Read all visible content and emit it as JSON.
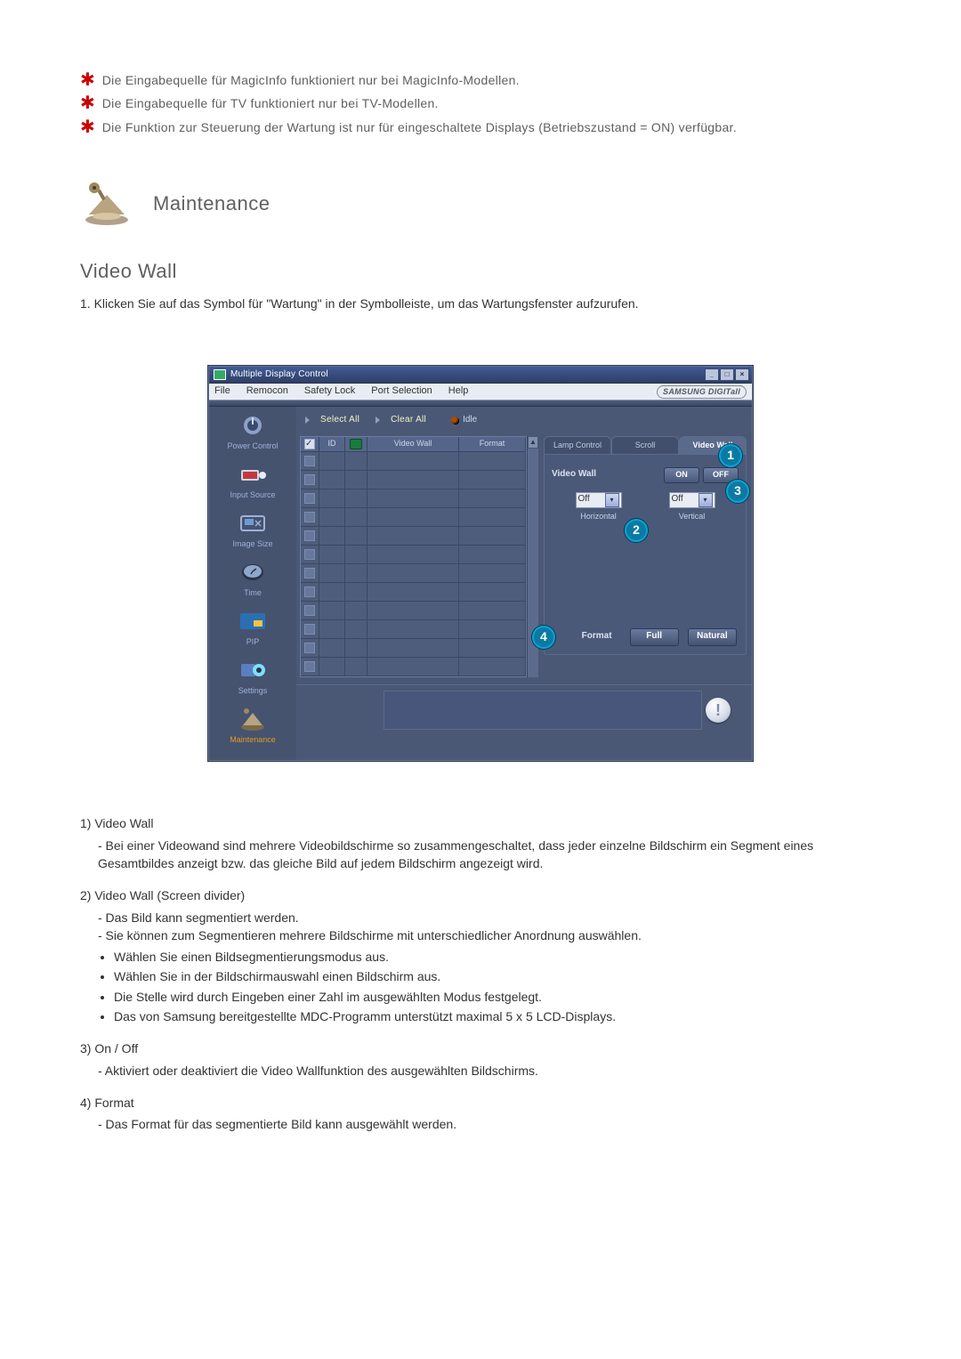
{
  "notes": [
    "Die Eingabequelle für MagicInfo funktioniert nur bei MagicInfo-Modellen.",
    "Die Eingabequelle für TV funktioniert nur bei TV-Modellen.",
    "Die Funktion zur Steuerung der Wartung ist nur für eingeschaltete Displays (Betriebszustand = ON) verfügbar."
  ],
  "section_title": "Maintenance",
  "subheading": "Video Wall",
  "step_text": "1. Klicken Sie auf das Symbol für \"Wartung\" in der Symbolleiste, um das Wartungsfenster aufzurufen.",
  "app": {
    "title": "Multiple Display Control",
    "menus": [
      "File",
      "Remocon",
      "Safety Lock",
      "Port Selection",
      "Help"
    ],
    "logo": "SAMSUNG DIGITall",
    "sidebar": [
      {
        "label": "Power Control"
      },
      {
        "label": "Input Source"
      },
      {
        "label": "Image Size"
      },
      {
        "label": "Time"
      },
      {
        "label": "PIP"
      },
      {
        "label": "Settings"
      },
      {
        "label": "Maintenance"
      }
    ],
    "toolbar": {
      "select_all": "Select All",
      "clear_all": "Clear All",
      "idle": "Idle"
    },
    "table": {
      "headers": {
        "id": "ID",
        "video_wall": "Video Wall",
        "format": "Format"
      },
      "row_count": 12
    },
    "panel": {
      "tabs": [
        "Lamp Control",
        "Scroll",
        "Video Wall"
      ],
      "active_tab_label": "Video Wall",
      "video_wall_label": "Video Wall",
      "on": "ON",
      "off": "OFF",
      "horizontal_label": "Horizontal",
      "vertical_label": "Vertical",
      "dd_value": "Off",
      "format_label": "Format",
      "full": "Full",
      "natural": "Natural"
    },
    "callouts": {
      "c1": "1",
      "c2": "2",
      "c3": "3",
      "c4": "4"
    },
    "status_icon": "!"
  },
  "definitions": [
    {
      "num": "1)",
      "title": "Video Wall",
      "lines": [
        "Bei einer Videowand sind mehrere Videobildschirme so zusammengeschaltet, dass jeder einzelne Bildschirm ein Segment eines Gesamtbildes anzeigt bzw. das gleiche Bild auf jedem Bildschirm angezeigt wird."
      ],
      "bullets": []
    },
    {
      "num": "2)",
      "title": "Video Wall (Screen divider)",
      "lines": [
        "Das Bild kann segmentiert werden.",
        "Sie können zum Segmentieren mehrere Bildschirme mit unterschiedlicher Anordnung auswählen."
      ],
      "bullets": [
        "Wählen Sie einen Bildsegmentierungsmodus aus.",
        "Wählen Sie in der Bildschirmauswahl einen Bildschirm aus.",
        "Die Stelle wird durch Eingeben einer Zahl im ausgewählten Modus festgelegt.",
        "Das von Samsung bereitgestellte MDC-Programm unterstützt maximal 5 x 5 LCD-Displays."
      ]
    },
    {
      "num": "3)",
      "title": "On / Off",
      "lines": [
        "Aktiviert oder deaktiviert die Video Wallfunktion des ausgewählten Bildschirms."
      ],
      "bullets": []
    },
    {
      "num": "4)",
      "title": "Format",
      "lines": [
        "Das Format für das segmentierte Bild kann ausgewählt werden."
      ],
      "bullets": []
    }
  ]
}
